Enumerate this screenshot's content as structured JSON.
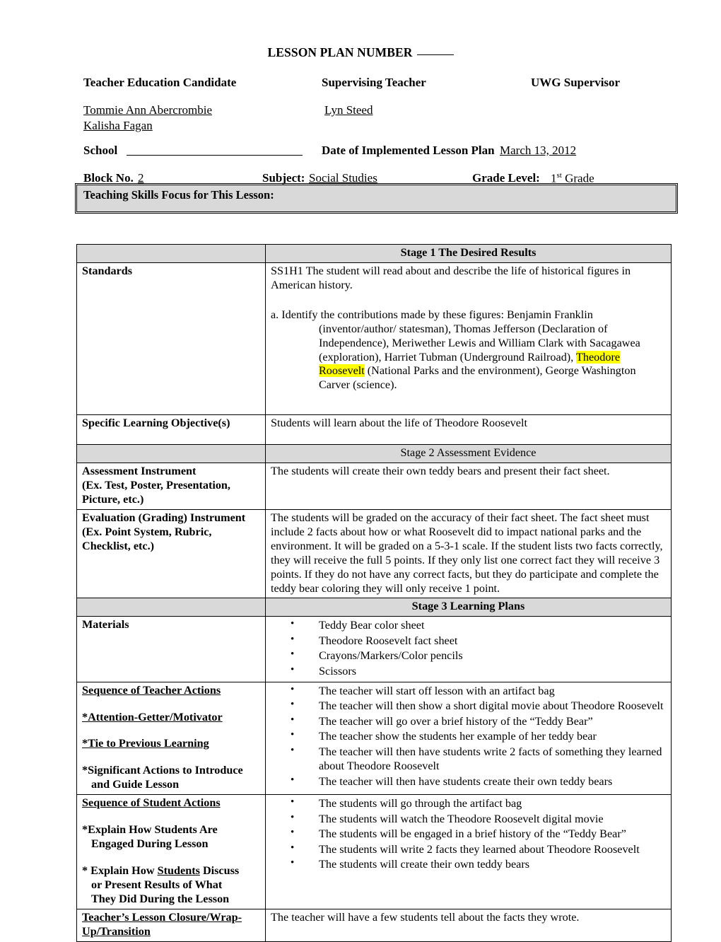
{
  "document": {
    "title": "LESSON PLAN NUMBER",
    "title_blank": ""
  },
  "header": {
    "labels": {
      "candidate": "Teacher Education Candidate",
      "supervising_teacher": "Supervising Teacher",
      "uwg_supervisor": "UWG Supervisor"
    },
    "values": {
      "candidate_line1": "Tommie Ann Abercrombie",
      "candidate_line2": "Kalisha Fagan",
      "supervising_teacher": " Lyn Steed",
      "uwg_supervisor": ""
    },
    "school_label": "School",
    "school_value": "",
    "date_label": "Date of Implemented Lesson Plan",
    "date_value": "March 13, 2012",
    "block_label": "Block No.",
    "block_value": "2",
    "subject_label": "Subject:",
    "subject_value": "Social Studies",
    "grade_label": "Grade Level:",
    "grade_value_num": "1",
    "grade_value_sup": "st",
    "grade_value_rest": " Grade"
  },
  "skills_focus": {
    "label": "Teaching Skills Focus for This Lesson:",
    "value": ""
  },
  "stage1": {
    "header": "Stage 1 The Desired Results",
    "standards_label": "Standards",
    "standards_intro": "SS1H1 The student will read about and describe the life of historical figures in American history.",
    "standards_a_marker": "a.",
    "standards_a_text_1": "Identify the contributions made by these figures: Benjamin Franklin",
    "standards_a_text_2": "(inventor/author/ statesman), Thomas Jefferson (Declaration of Independence), Meriwether Lewis and William Clark with Sacagawea (exploration), Harriet Tubman (Underground Railroad), ",
    "standards_a_highlight": "Theodore Roosevelt",
    "standards_a_text_3": " (National Parks and the environment), George Washington Carver (science).",
    "objective_label": "Specific Learning Objective(s)",
    "objective_value": "Students will learn about the life of Theodore Roosevelt"
  },
  "stage2": {
    "header": "Stage 2 Assessment Evidence",
    "assessment_label_line1": " Assessment Instrument",
    "assessment_label_line2": "(Ex. Test, Poster, Presentation,",
    "assessment_label_line3": "Picture, etc.)",
    "assessment_value": "The students will create their own teddy bears and present their fact sheet.",
    "evaluation_label_line1": " Evaluation (Grading) Instrument",
    "evaluation_label_line2": "(Ex. Point System, Rubric,",
    "evaluation_label_line3": "Checklist, etc.)",
    "evaluation_value": "The students will be graded on the accuracy of their fact sheet. The fact sheet must include 2 facts about how or what Roosevelt did to impact national parks and the environment. It will be graded on a 5-3-1 scale. If the student lists two facts correctly, they will receive the full 5 points. If they only list one correct fact they will receive 3 points. If they do not have any correct facts, but they do participate and complete the teddy bear coloring they will only receive 1 point."
  },
  "stage3": {
    "header": "Stage 3 Learning Plans",
    "materials_label": "Materials",
    "materials_items": [
      "Teddy Bear color sheet",
      "Theodore Roosevelt fact sheet",
      "Crayons/Markers/Color pencils",
      "Scissors"
    ],
    "teacher_actions_label": "Sequence of Teacher Actions",
    "teacher_actions_sub1": "*Attention-Getter/Motivator",
    "teacher_actions_sub2": "*Tie to Previous Learning",
    "teacher_actions_sub3_line1": "*Significant Actions to Introduce",
    "teacher_actions_sub3_line2": "and Guide Lesson",
    "teacher_actions_items": [
      "The teacher will start off lesson with an artifact bag",
      "The teacher will then show a short digital movie about Theodore Roosevelt",
      "The teacher will go over a brief history of the “Teddy Bear”",
      "The teacher show the students her example of her teddy bear",
      "The teacher will then have students write 2 facts of something they learned about Theodore Roosevelt",
      "The teacher will then have students create their own teddy bears"
    ],
    "student_actions_label": "Sequence of Student Actions",
    "student_actions_sub1_line1": "*Explain How Students Are",
    "student_actions_sub1_line2": "Engaged During Lesson",
    "student_actions_sub2_pre": "* Explain How ",
    "student_actions_sub2_u": "Students",
    "student_actions_sub2_post": " Discuss",
    "student_actions_sub2_line2": "or Present Results of What",
    "student_actions_sub2_line3": "They Did During the Lesson",
    "student_actions_items": [
      "The students will go through the artifact bag",
      "The students will watch the Theodore Roosevelt digital movie",
      "The students will be engaged in a brief history of the “Teddy Bear”",
      "The students will write 2 facts they learned about Theodore Roosevelt",
      "The students will create their own teddy bears"
    ],
    "closure_label_line1": "Teacher’s Lesson Closure/Wrap-",
    "closure_label_line2": "Up/Transition ",
    "closure_value": "The teacher will have a few students tell about the facts they wrote."
  },
  "colors": {
    "highlight": "#ffff00",
    "header_fill": "#d9d9d9",
    "border": "#000000"
  }
}
